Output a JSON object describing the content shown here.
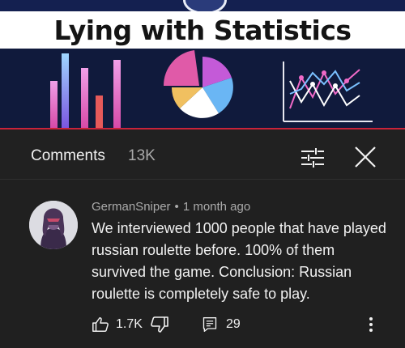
{
  "thumbnail": {
    "title": "Lying with Statistics",
    "colors": {
      "background": "#101a3c",
      "accent_line": "#c8233a"
    }
  },
  "comments_panel": {
    "title": "Comments",
    "count": "13K",
    "filter_icon": "sort-filter-icon",
    "close_icon": "close-icon"
  },
  "comment": {
    "author": "GermanSniper",
    "separator": "•",
    "time": "1 month ago",
    "text": "We interviewed 1000 people that have played russian roulette before. 100% of them survived the game. Conclusion: Russian roulette is completely safe to play.",
    "likes": "1.7K",
    "replies": "29",
    "icons": [
      "thumbs-up-icon",
      "thumbs-down-icon",
      "reply-icon",
      "more-vertical-icon"
    ]
  },
  "colors": {
    "panel_background": "#212121",
    "text_primary": "#f1f1f1",
    "text_secondary": "#aaaaaa"
  }
}
